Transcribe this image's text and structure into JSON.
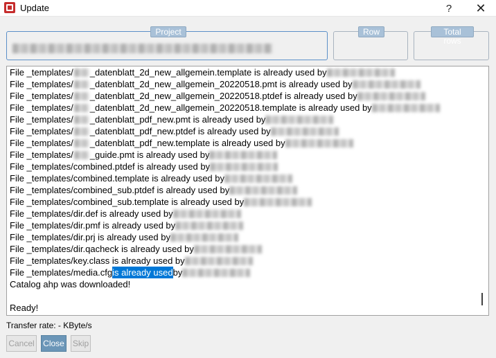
{
  "window": {
    "title": "Update",
    "help_label": "?",
    "close_label": "✕"
  },
  "fields": {
    "project_label": "Project",
    "row_label": "Row",
    "total_rows_label": "Total rows"
  },
  "log": {
    "lines": [
      {
        "pre": "File _templates/",
        "mid": "_datenblatt_2d_new_allgemein.template is already used by ",
        "blur_path": true,
        "blur_user": 98
      },
      {
        "pre": "File _templates/",
        "mid": "_datenblatt_2d_new_allgemein_20220518.pmt is already used by ",
        "blur_path": true,
        "blur_user": 98
      },
      {
        "pre": "File _templates/",
        "mid": "_datenblatt_2d_new_allgemein_20220518.ptdef is already used by ",
        "blur_path": true,
        "blur_user": 98
      },
      {
        "pre": "File _templates/",
        "mid": "_datenblatt_2d_new_allgemein_20220518.template is already used by ",
        "blur_path": true,
        "blur_user": 98
      },
      {
        "pre": "File _templates/",
        "mid": "_datenblatt_pdf_new.pmt is already used by ",
        "blur_path": true,
        "blur_user": 98
      },
      {
        "pre": "File _templates/",
        "mid": "_datenblatt_pdf_new.ptdef is already used by ",
        "blur_path": true,
        "blur_user": 98
      },
      {
        "pre": "File _templates/",
        "mid": "_datenblatt_pdf_new.template is already used by ",
        "blur_path": true,
        "blur_user": 98
      },
      {
        "pre": "File _templates/",
        "mid": "_guide.pmt is already used by ",
        "blur_path": true,
        "blur_user": 98
      },
      {
        "pre": "File _templates/combined.ptdef is already used by ",
        "mid": "",
        "blur_path": false,
        "blur_user": 98
      },
      {
        "pre": "File _templates/combined.template is already used by ",
        "mid": "",
        "blur_path": false,
        "blur_user": 98
      },
      {
        "pre": "File _templates/combined_sub.ptdef is already used by ",
        "mid": "",
        "blur_path": false,
        "blur_user": 98
      },
      {
        "pre": "File _templates/combined_sub.template is already used by ",
        "mid": "",
        "blur_path": false,
        "blur_user": 98
      },
      {
        "pre": "File _templates/dir.def is already used by ",
        "mid": "",
        "blur_path": false,
        "blur_user": 98
      },
      {
        "pre": "File _templates/dir.pmf is already used by ",
        "mid": "",
        "blur_path": false,
        "blur_user": 98
      },
      {
        "pre": "File _templates/dir.prj is already used by ",
        "mid": "",
        "blur_path": false,
        "blur_user": 98
      },
      {
        "pre": "File _templates/dir.qacheck is already used by ",
        "mid": "",
        "blur_path": false,
        "blur_user": 98
      },
      {
        "pre": "File _templates/key.class is already used by ",
        "mid": "",
        "blur_path": false,
        "blur_user": 98
      }
    ],
    "media_line": {
      "pre": "File _templates/media.cfg ",
      "selected": "is already used",
      "post": " by "
    },
    "catalog_line": "Catalog ahp was downloaded!",
    "ready_line": "Ready!"
  },
  "status": {
    "transfer_rate": "Transfer rate: - KByte/s"
  },
  "buttons": {
    "cancel": "Cancel",
    "close": "Close",
    "skip": "Skip"
  }
}
